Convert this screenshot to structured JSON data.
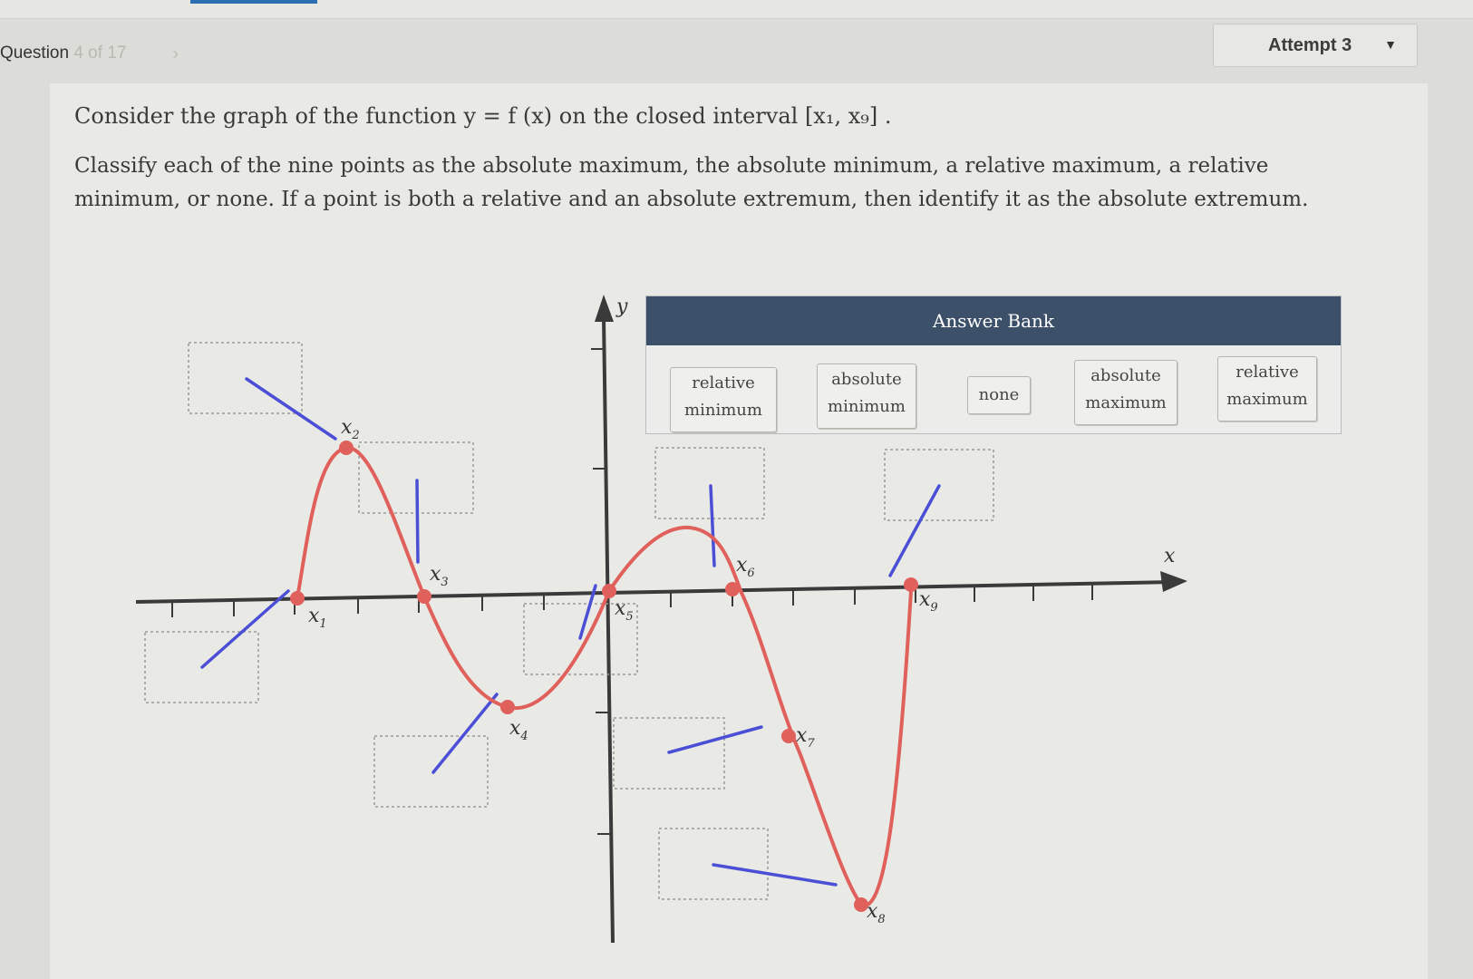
{
  "header": {
    "question_label": "Question",
    "question_counter": "4 of 17",
    "next_chevron": "chevron-right-icon",
    "attempt_label": "Attempt 3",
    "attempt_caret": "caret-down-icon"
  },
  "prompt": "Consider the graph of the function y = f (x) on the closed interval [x₁, x₉] .",
  "instructions": "Classify each of the nine points as the absolute maximum, the absolute minimum, a relative maximum, a relative minimum, or none. If a point is both a relative and an absolute extremum, then identify it as the absolute extremum.",
  "answer_bank": {
    "title": "Answer Bank",
    "items": [
      {
        "line1": "relative",
        "line2": "minimum"
      },
      {
        "line1": "absolute",
        "line2": "minimum"
      },
      {
        "line1": "none",
        "line2": ""
      },
      {
        "line1": "absolute",
        "line2": "maximum"
      },
      {
        "line1": "relative",
        "line2": "maximum"
      }
    ]
  },
  "graph": {
    "x_axis_label": "x",
    "y_axis_label": "y",
    "points": [
      {
        "name": "x",
        "sub": "1"
      },
      {
        "name": "x",
        "sub": "2"
      },
      {
        "name": "x",
        "sub": "3"
      },
      {
        "name": "x",
        "sub": "4"
      },
      {
        "name": "x",
        "sub": "5"
      },
      {
        "name": "x",
        "sub": "6"
      },
      {
        "name": "x",
        "sub": "7"
      },
      {
        "name": "x",
        "sub": "8"
      },
      {
        "name": "x",
        "sub": "9"
      }
    ],
    "curve_color": "#e0605c",
    "leader_color": "#4a4fd6",
    "axis_color": "#3a3a3a"
  }
}
